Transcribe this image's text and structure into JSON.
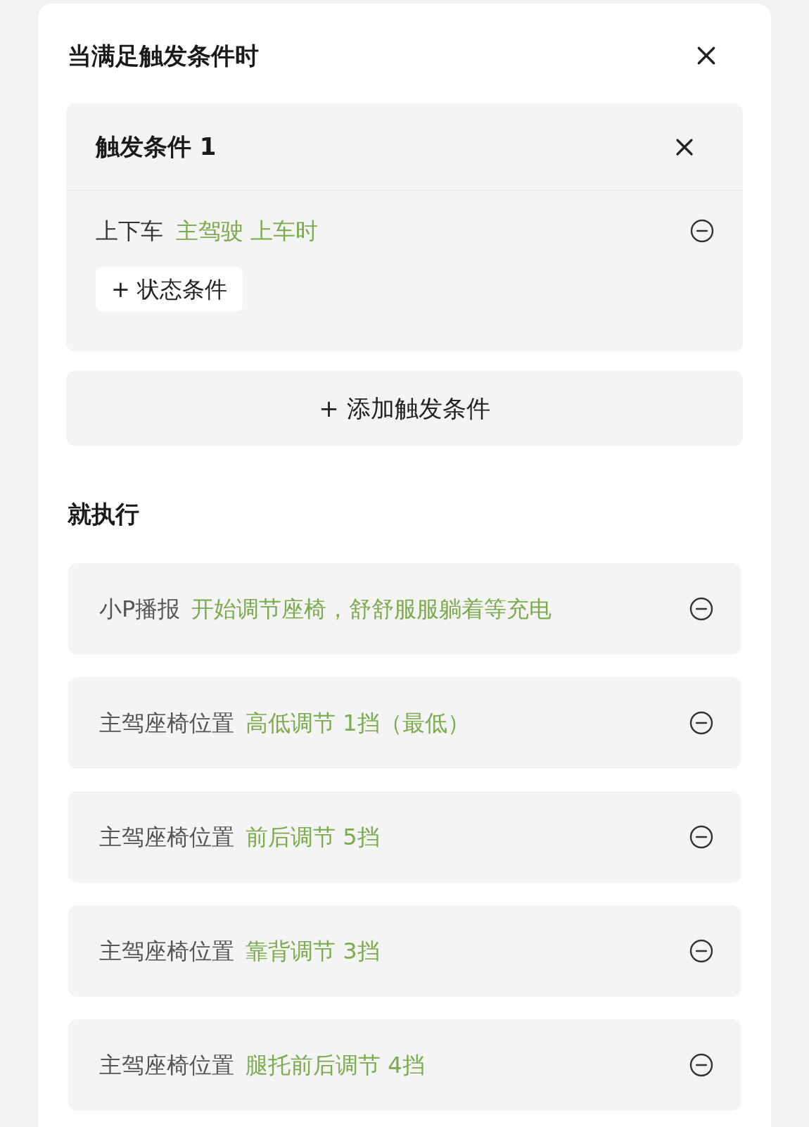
{
  "title": "当满足触发条件时",
  "trigger_groups": [
    {
      "title": "触发条件 1",
      "conditions": [
        {
          "label": "上下车",
          "value": "主驾驶 上车时"
        }
      ],
      "add_state_button": "+ 状态条件"
    }
  ],
  "add_trigger_button": "+ 添加触发条件",
  "actions_title": "就执行",
  "actions": [
    {
      "label": "小P播报",
      "value": "开始调节座椅，舒舒服服躺着等充电"
    },
    {
      "label": "主驾座椅位置",
      "value": "高低调节 1挡（最低）"
    },
    {
      "label": "主驾座椅位置",
      "value": "前后调节 5挡"
    },
    {
      "label": "主驾座椅位置",
      "value": "靠背调节 3挡"
    },
    {
      "label": "主驾座椅位置",
      "value": "腿托前后调节 4挡"
    }
  ]
}
